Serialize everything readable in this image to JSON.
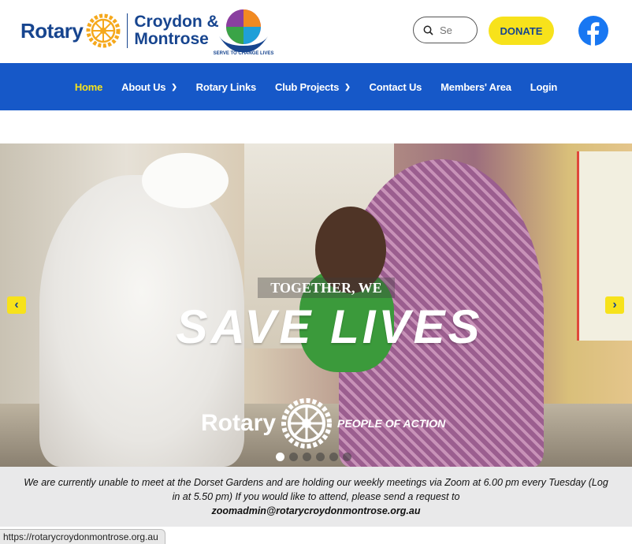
{
  "header": {
    "logo_word": "Rotary",
    "club_line1": "Croydon &",
    "club_line2": "Montrose",
    "stc_caption": "SERVE TO CHANGE LIVES",
    "search_placeholder": "Se",
    "donate_label": "DONATE"
  },
  "nav": {
    "items": [
      {
        "label": "Home",
        "active": true
      },
      {
        "label": "About Us",
        "dropdown": true
      },
      {
        "label": "Rotary Links"
      },
      {
        "label": "Club Projects",
        "dropdown": true
      },
      {
        "label": "Contact Us"
      },
      {
        "label": "Members' Area"
      },
      {
        "label": "Login"
      }
    ]
  },
  "slider": {
    "tag_line1": "TOGETHER, WE",
    "tag_line2": "SAVE LIVES",
    "brand_word": "Rotary",
    "brand_tagline": "PEOPLE OF ACTION",
    "prev_label": "‹",
    "next_label": "›",
    "dots_total": 6,
    "dots_active": 1
  },
  "notice": {
    "text": "We are currently unable to meet at the Dorset Gardens and are holding our weekly meetings via Zoom at 6.00 pm every Tuesday (Log in at 5.50 pm) If you would like to attend, please send a request to",
    "email": "zoomadmin@rotarycroydonmontrose.org.au"
  },
  "status_bar": {
    "url": "https://rotarycroydonmontrose.org.au"
  },
  "colors": {
    "rotary_blue": "#17458f",
    "nav_blue": "#1658c8",
    "gold": "#f7e21b",
    "facebook_blue": "#1877f2"
  }
}
